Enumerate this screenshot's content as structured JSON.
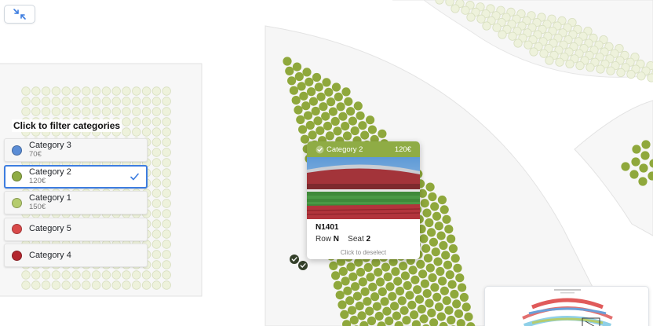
{
  "filter_panel": {
    "title": "Click to filter categories",
    "categories": [
      {
        "name": "Category 3",
        "price": "70€",
        "color": "#5b8dd6",
        "selected": false
      },
      {
        "name": "Category 2",
        "price": "120€",
        "color": "#8fac45",
        "selected": true
      },
      {
        "name": "Category 1",
        "price": "150€",
        "color": "#b5cc6e",
        "selected": false
      },
      {
        "name": "Category 5",
        "price": "",
        "color": "#d94a4a",
        "selected": false
      },
      {
        "name": "Category 4",
        "price": "",
        "color": "#b3262e",
        "selected": false
      }
    ]
  },
  "seat_popup": {
    "category": "Category 2",
    "price": "120€",
    "seat_id": "N1401",
    "row_label": "Row",
    "row": "N",
    "seat_label": "Seat",
    "seat": "2",
    "hint": "Click to deselect"
  },
  "icons": {
    "exit": "collapse-arrows-icon",
    "check": "check-icon"
  },
  "colors": {
    "available_seat": "#8fa83c",
    "unavailable_seat": "#eef2dc",
    "selected_border": "#3d7de0",
    "popup_header": "#8fac45",
    "selected_seat": "#34402a"
  }
}
